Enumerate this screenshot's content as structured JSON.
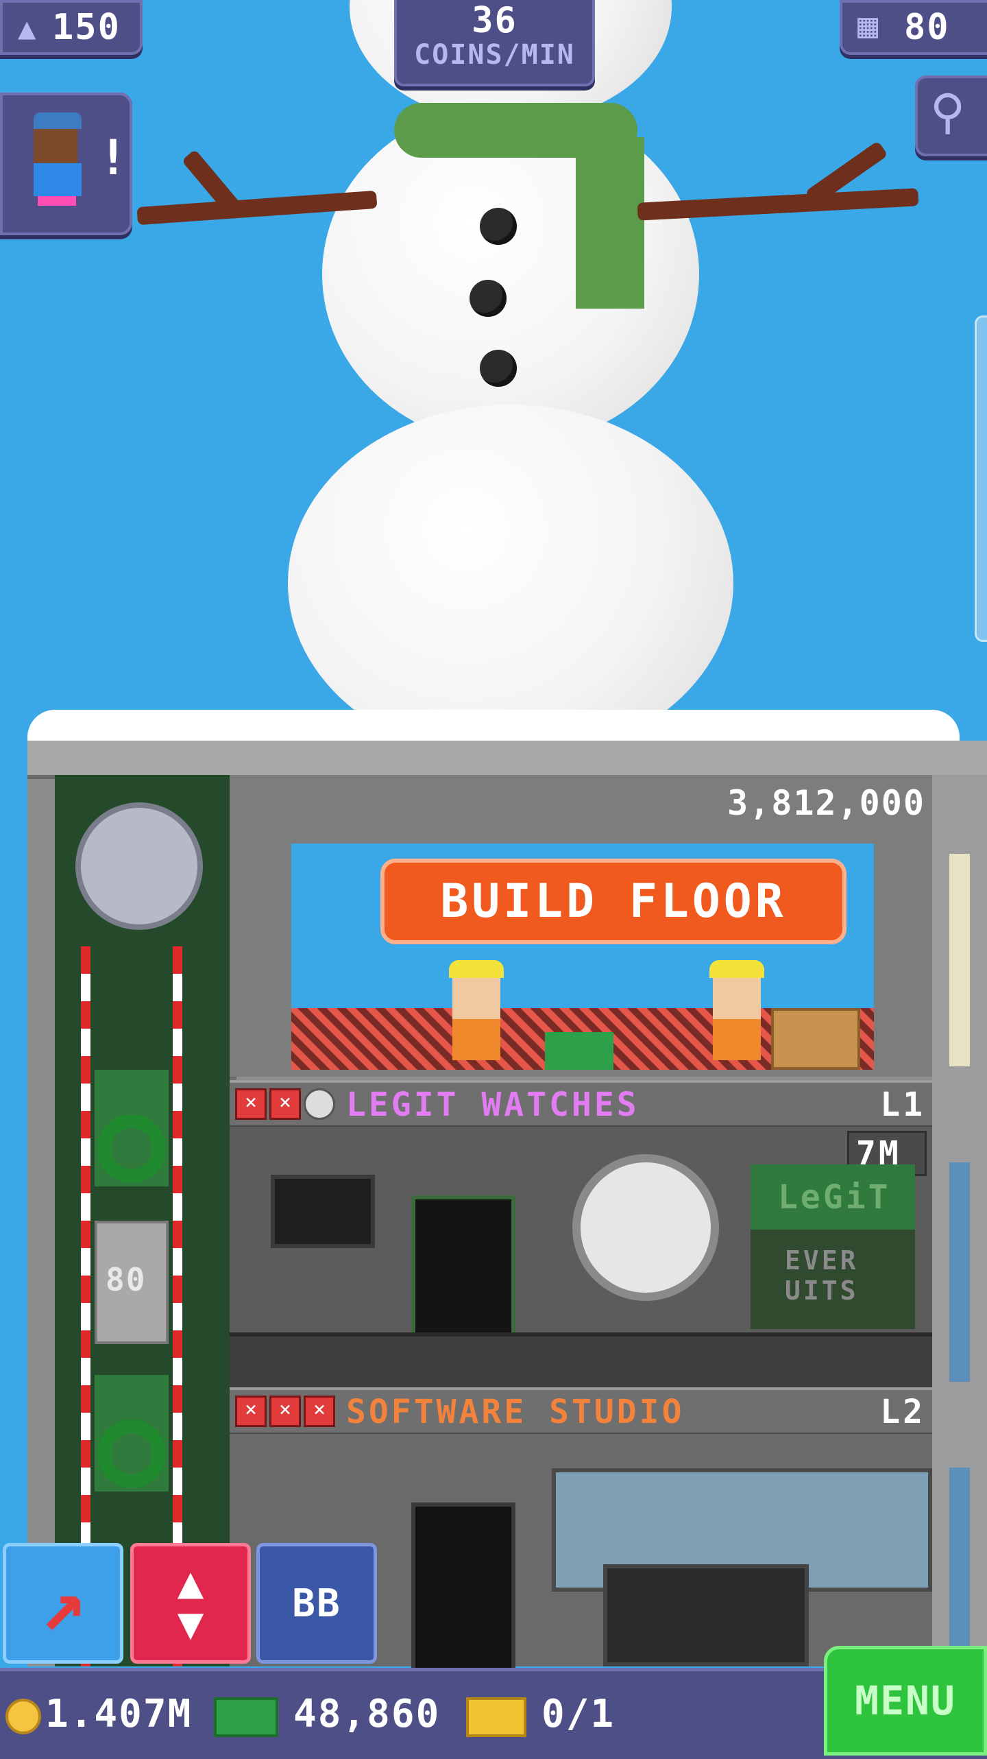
{
  "hud": {
    "population": "150",
    "coins_per_min_value": "36",
    "coins_per_min_label": "COINS/MIN",
    "floors_count": "80"
  },
  "tower": {
    "build_floor_cost": "3,812,000",
    "build_floor_label": "BUILD FLOOR",
    "floors": [
      {
        "name": "LEGIT WATCHES",
        "level": "L1",
        "stock": "7M",
        "sign_text": "LeGiT",
        "sign_sub": "EVER\nUITS"
      },
      {
        "name": "SOFTWARE STUDIO",
        "level": "L2"
      }
    ],
    "elevator_floor_label": "80"
  },
  "toolbar": {
    "move_icon": "arrow-icon",
    "elevator_icon": "updown-icon",
    "bb_label": "BB",
    "menu_label": "MENU"
  },
  "bottom_bar": {
    "coins": "1.407M",
    "bux": "48,860",
    "tickets": "0/1"
  },
  "colors": {
    "sky": "#3aa7e6",
    "hud_bg": "#4e4f86",
    "build_button": "#f05a1f",
    "legit_watches": "#e27cf2",
    "software_studio": "#f2823c",
    "menu": "#2fc43d"
  }
}
